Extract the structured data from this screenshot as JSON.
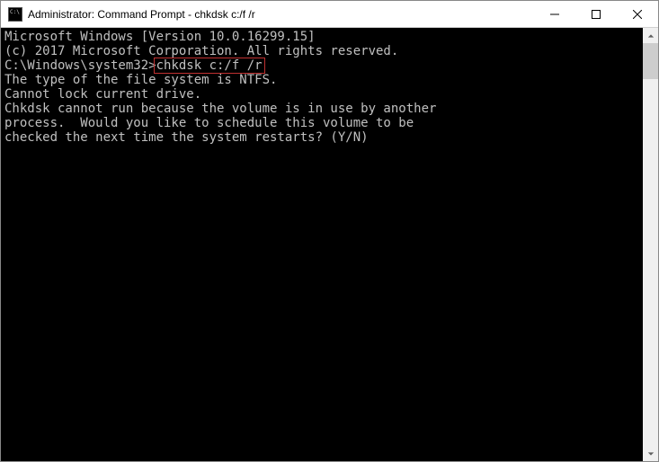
{
  "titlebar": {
    "title": "Administrator: Command Prompt - chkdsk  c:/f /r"
  },
  "console": {
    "line1": "Microsoft Windows [Version 10.0.16299.15]",
    "line2": "(c) 2017 Microsoft Corporation. All rights reserved.",
    "blank1": "",
    "prompt_path": "C:\\Windows\\system32>",
    "command": "chkdsk c:/f /r",
    "line4": "The type of the file system is NTFS.",
    "line5": "Cannot lock current drive.",
    "blank2": "",
    "line6": "Chkdsk cannot run because the volume is in use by another",
    "line7": "process.  Would you like to schedule this volume to be",
    "line8": "checked the next time the system restarts? (Y/N)"
  }
}
